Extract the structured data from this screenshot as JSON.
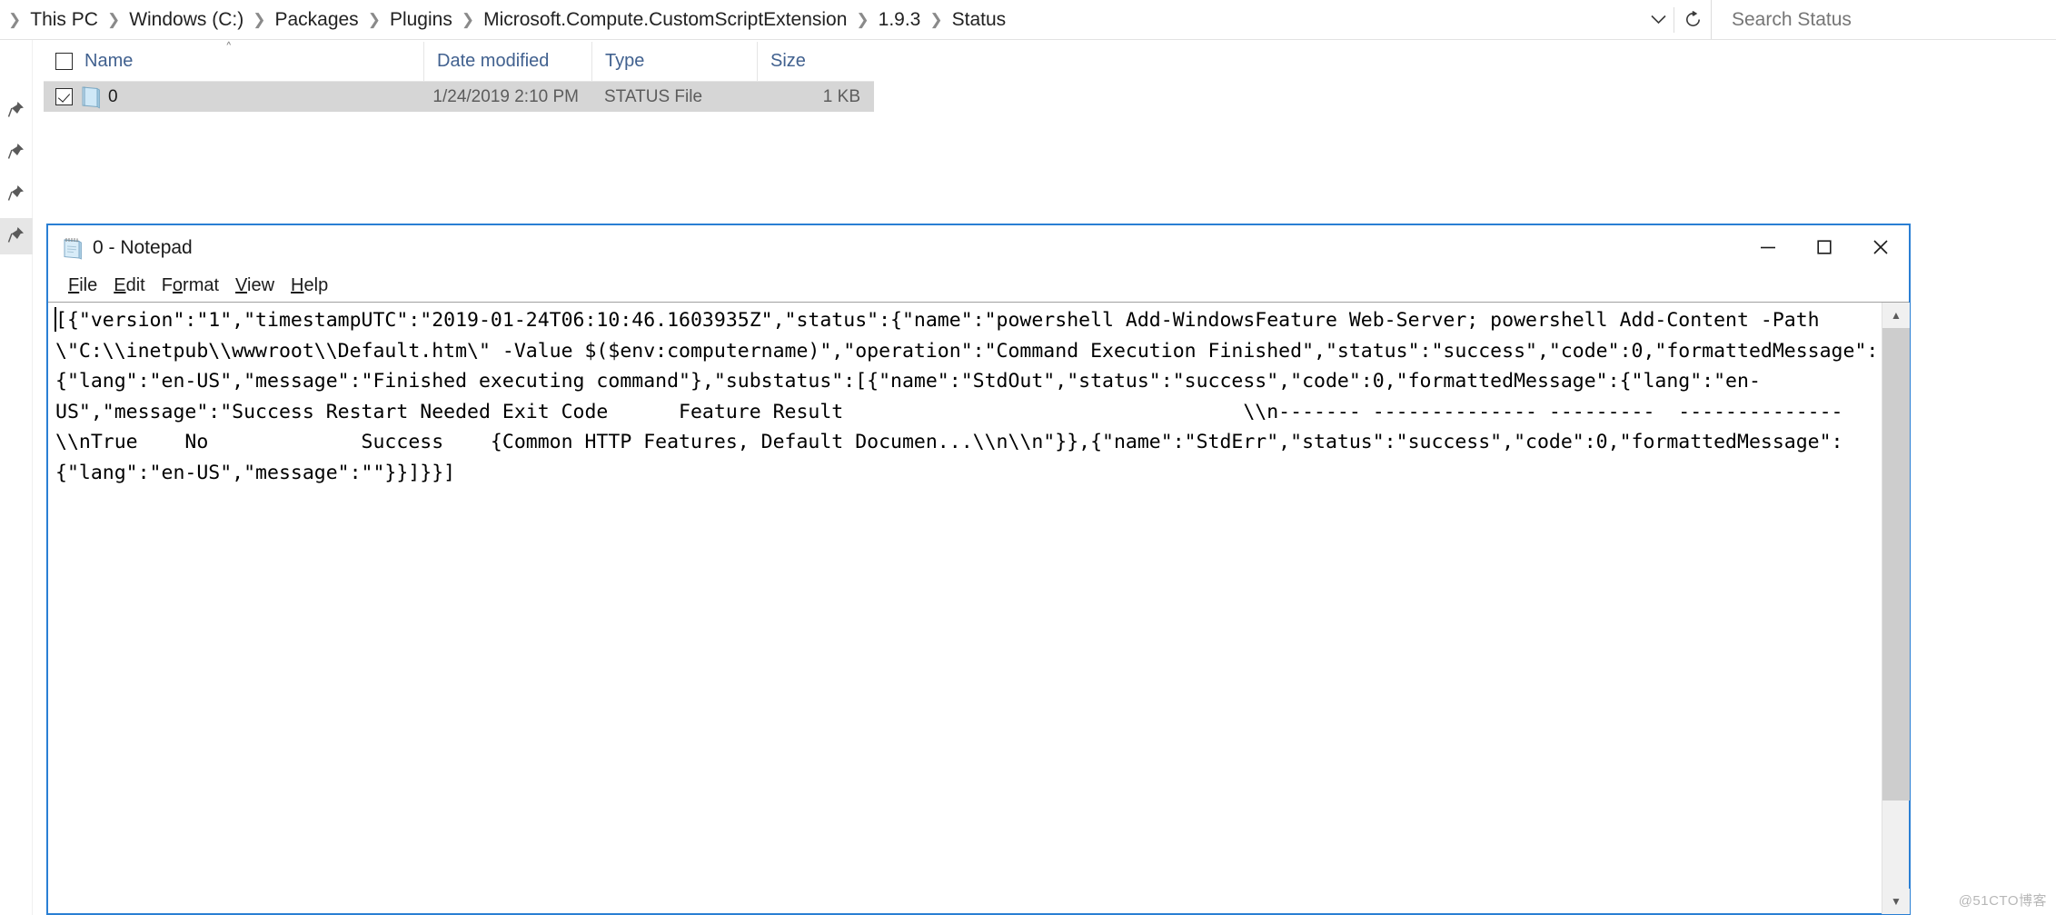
{
  "explorer": {
    "breadcrumb": {
      "items": [
        "This PC",
        "Windows (C:)",
        "Packages",
        "Plugins",
        "Microsoft.Compute.CustomScriptExtension",
        "1.9.3",
        "Status"
      ],
      "separator": "❯",
      "dropdown_icon": "chevron-down-icon",
      "refresh_icon": "refresh-icon"
    },
    "search": {
      "placeholder": "Search Status",
      "value": ""
    },
    "columns": [
      {
        "label": "Name",
        "sort": "ascending"
      },
      {
        "label": "Date modified",
        "sort": "none"
      },
      {
        "label": "Type",
        "sort": "none"
      },
      {
        "label": "Size",
        "sort": "none"
      }
    ],
    "sort_caret": "˄",
    "rows": [
      {
        "selected": true,
        "checked": true,
        "name": "0",
        "icon": "status-file-icon",
        "date_modified": "1/24/2019 2:10 PM",
        "type": "STATUS File",
        "size": "1 KB"
      }
    ],
    "colors": {
      "header_text": "#41618f",
      "row_selected_bg": "#d6d6d6",
      "accent": "#2a7fd4"
    }
  },
  "notepad": {
    "title": "0 - Notepad",
    "icon": "notepad-icon",
    "menus": [
      {
        "label": "File",
        "accel": "F"
      },
      {
        "label": "Edit",
        "accel": "E"
      },
      {
        "label": "Format",
        "accel": "o"
      },
      {
        "label": "View",
        "accel": "V"
      },
      {
        "label": "Help",
        "accel": "H"
      }
    ],
    "window_controls": {
      "minimize": "—",
      "maximize": "□",
      "close": "✕"
    },
    "content": "[{\"version\":\"1\",\"timestampUTC\":\"2019-01-24T06:10:46.1603935Z\",\"status\":{\"name\":\"powershell Add-WindowsFeature Web-Server; powershell Add-Content -Path \\\"C:\\\\inetpub\\\\wwwroot\\\\Default.htm\\\" -Value $($env:computername)\",\"operation\":\"Command Execution Finished\",\"status\":\"success\",\"code\":0,\"formattedMessage\":{\"lang\":\"en-US\",\"message\":\"Finished executing command\"},\"substatus\":[{\"name\":\"StdOut\",\"status\":\"success\",\"code\":0,\"formattedMessage\":{\"lang\":\"en-US\",\"message\":\"Success Restart Needed Exit Code      Feature Result                                  \\\\n------- -------------- ---------  --------------                                 \\\\nTrue    No             Success    {Common HTTP Features, Default Documen...\\\\n\\\\n\"}},{\"name\":\"StdErr\",\"status\":\"success\",\"code\":0,\"formattedMessage\":{\"lang\":\"en-US\",\"message\":\"\"}}]}}]",
    "scrollbar": {
      "up_arrow": "▲",
      "down_arrow": "▼"
    }
  },
  "watermark": "@51CTO博客"
}
